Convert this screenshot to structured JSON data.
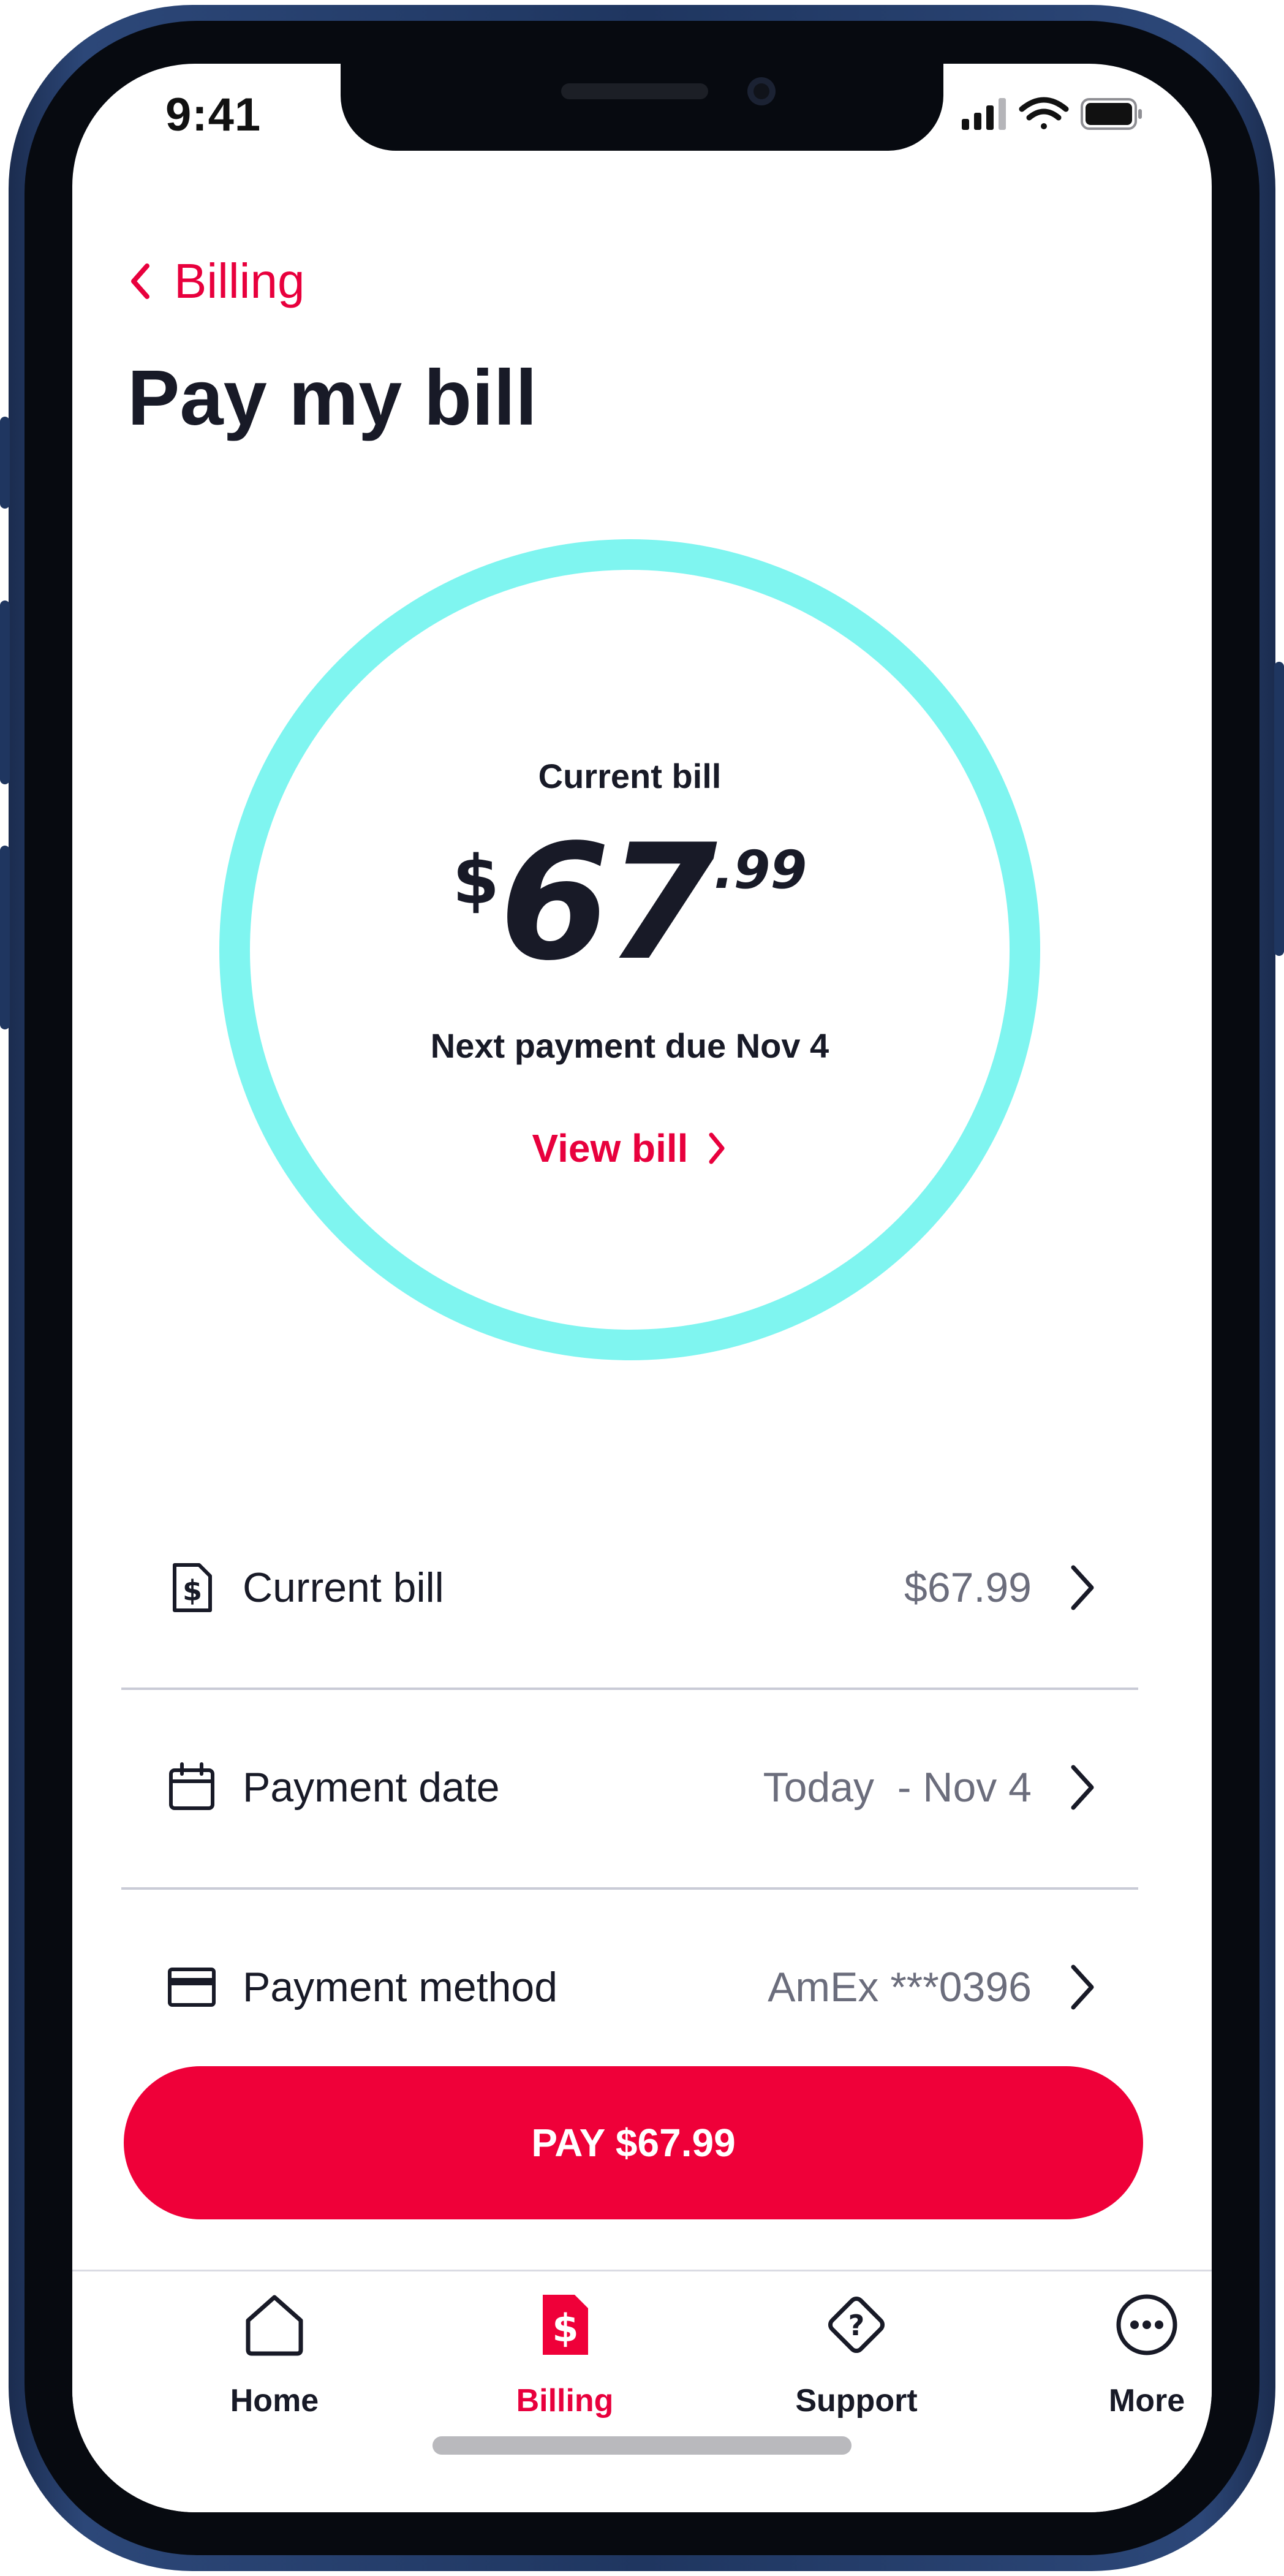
{
  "status_bar": {
    "time": "9:41"
  },
  "header": {
    "back_label": "Billing",
    "title": "Pay my bill"
  },
  "summary": {
    "label": "Current bill",
    "amount_currency": "$",
    "amount_integer": "67",
    "amount_decimal": ".99",
    "due_text": "Next payment due Nov 4",
    "view_bill_label": "View bill",
    "ring_color": "#7ff5f0"
  },
  "rows": [
    {
      "icon": "dollar-doc-icon",
      "label": "Current bill",
      "value": "$67.99"
    },
    {
      "icon": "calendar-icon",
      "label": "Payment date",
      "value": "Today  - Nov 4"
    },
    {
      "icon": "credit-card-icon",
      "label": "Payment method",
      "value": "AmEx ***0396"
    }
  ],
  "pay_button": {
    "label": "PAY $67.99",
    "color": "#ef0039"
  },
  "tabs": [
    {
      "icon": "home-icon",
      "label": "Home",
      "active": false
    },
    {
      "icon": "billing-icon",
      "label": "Billing",
      "active": true
    },
    {
      "icon": "support-icon",
      "label": "Support",
      "active": false
    },
    {
      "icon": "more-icon",
      "label": "More",
      "active": false
    }
  ],
  "colors": {
    "accent": "#e8003d",
    "text": "#181a27",
    "muted": "#6b6d7c"
  }
}
